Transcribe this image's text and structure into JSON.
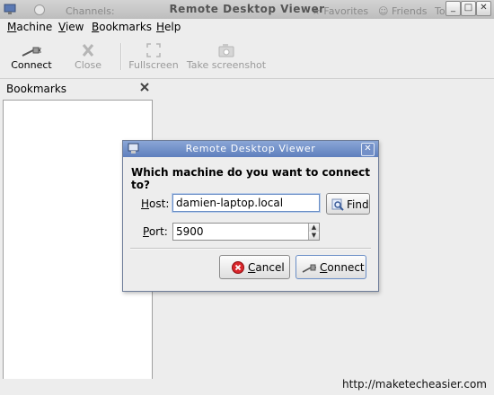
{
  "window": {
    "title": "Remote Desktop Viewer",
    "background_panel_texts": {
      "channels": "Channels:",
      "favorites": "Favorites",
      "friends": "Friends",
      "tools": "Tools"
    }
  },
  "menubar": {
    "items": [
      {
        "label": "Machine",
        "mnemonic": "M",
        "rest": "achine"
      },
      {
        "label": "View",
        "mnemonic": "V",
        "rest": "iew"
      },
      {
        "label": "Bookmarks",
        "mnemonic": "B",
        "rest": "ookmarks"
      },
      {
        "label": "Help",
        "mnemonic": "H",
        "rest": "elp"
      }
    ]
  },
  "toolbar": {
    "connect_label": "Connect",
    "close_label": "Close",
    "fullscreen_label": "Fullscreen",
    "screenshot_label": "Take screenshot"
  },
  "bookmarks_panel": {
    "title": "Bookmarks"
  },
  "dialog": {
    "title": "Remote Desktop Viewer",
    "question": "Which machine do you want to connect to?",
    "host_label_mnemonic": "H",
    "host_label_rest": "ost:",
    "host_value": "damien-laptop.local",
    "find_label": "Find",
    "port_label_mnemonic": "P",
    "port_label_rest": "ort:",
    "port_value": "5900",
    "cancel_mnemonic": "C",
    "cancel_rest": "ancel",
    "connect_mnemonic": "C",
    "connect_rest": "onnect"
  },
  "watermark": "http://maketecheasier.com",
  "colors": {
    "dialog_titlebar": "#6f8fc9",
    "cancel_icon": "#d9262b"
  }
}
